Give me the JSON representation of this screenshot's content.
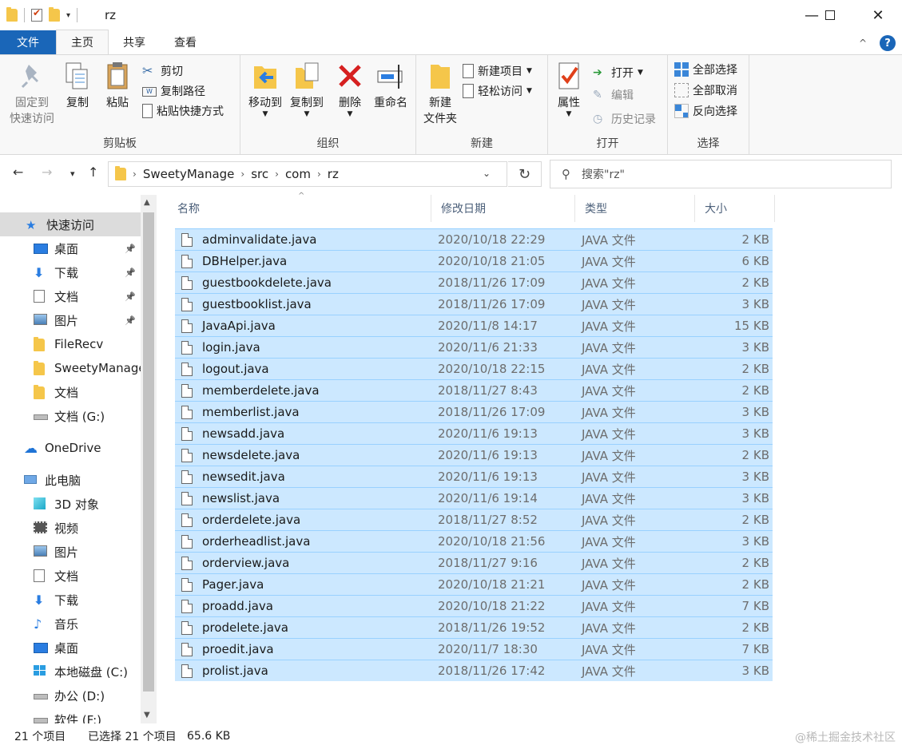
{
  "window": {
    "title": "rz"
  },
  "ribbon_tabs": [
    "文件",
    "主页",
    "共享",
    "查看"
  ],
  "ribbon": {
    "clipboard": {
      "label": "剪贴板",
      "pin_line1": "固定到",
      "pin_line2": "快速访问",
      "copy": "复制",
      "paste": "粘贴",
      "cut": "剪切",
      "copy_path": "复制路径",
      "paste_shortcut": "粘贴快捷方式"
    },
    "organize": {
      "label": "组织",
      "move_to": "移动到",
      "copy_to": "复制到",
      "delete": "删除",
      "rename": "重命名"
    },
    "new": {
      "label": "新建",
      "new_folder_line1": "新建",
      "new_folder_line2": "文件夹",
      "new_item": "新建项目",
      "easy_access": "轻松访问"
    },
    "open": {
      "label": "打开",
      "properties": "属性",
      "open": "打开",
      "edit": "编辑",
      "history": "历史记录"
    },
    "select": {
      "label": "选择",
      "select_all": "全部选择",
      "select_none": "全部取消",
      "invert": "反向选择"
    }
  },
  "address": {
    "segments": [
      "SweetyManage",
      "src",
      "com",
      "rz"
    ]
  },
  "search": {
    "placeholder": "搜索\"rz\""
  },
  "nav_items": [
    {
      "label": "快速访问",
      "icon": "star-icon",
      "pinned": false,
      "level": 0
    },
    {
      "label": "桌面",
      "icon": "desktop-icon",
      "pinned": true,
      "level": 1
    },
    {
      "label": "下载",
      "icon": "download-icon",
      "pinned": true,
      "level": 1
    },
    {
      "label": "文档",
      "icon": "document-icon",
      "pinned": true,
      "level": 1
    },
    {
      "label": "图片",
      "icon": "picture-icon",
      "pinned": true,
      "level": 1
    },
    {
      "label": "FileRecv",
      "icon": "folder-icon",
      "pinned": false,
      "level": 1
    },
    {
      "label": "SweetyManage",
      "icon": "folder-icon",
      "pinned": false,
      "level": 1
    },
    {
      "label": "文档",
      "icon": "folder-icon",
      "pinned": false,
      "level": 1
    },
    {
      "label": "文档 (G:)",
      "icon": "drive-icon",
      "pinned": false,
      "level": 1
    },
    {
      "label": "OneDrive",
      "icon": "cloud-icon",
      "pinned": false,
      "level": 0
    },
    {
      "label": "此电脑",
      "icon": "computer-icon",
      "pinned": false,
      "level": 0
    },
    {
      "label": "3D 对象",
      "icon": "cube-icon",
      "pinned": false,
      "level": 1
    },
    {
      "label": "视频",
      "icon": "video-icon",
      "pinned": false,
      "level": 1
    },
    {
      "label": "图片",
      "icon": "picture-icon",
      "pinned": false,
      "level": 1
    },
    {
      "label": "文档",
      "icon": "document-icon",
      "pinned": false,
      "level": 1
    },
    {
      "label": "下载",
      "icon": "download-icon",
      "pinned": false,
      "level": 1
    },
    {
      "label": "音乐",
      "icon": "music-icon",
      "pinned": false,
      "level": 1
    },
    {
      "label": "桌面",
      "icon": "desktop-icon",
      "pinned": false,
      "level": 1
    },
    {
      "label": "本地磁盘 (C:)",
      "icon": "windows-drive-icon",
      "pinned": false,
      "level": 1
    },
    {
      "label": "办公 (D:)",
      "icon": "drive-icon",
      "pinned": false,
      "level": 1
    },
    {
      "label": "软件 (F:)",
      "icon": "drive-icon",
      "pinned": false,
      "level": 1
    }
  ],
  "columns": {
    "name": "名称",
    "date": "修改日期",
    "type": "类型",
    "size": "大小"
  },
  "files": [
    {
      "name": "adminvalidate.java",
      "date": "2020/10/18 22:29",
      "type": "JAVA 文件",
      "size": "2 KB"
    },
    {
      "name": "DBHelper.java",
      "date": "2020/10/18 21:05",
      "type": "JAVA 文件",
      "size": "6 KB"
    },
    {
      "name": "guestbookdelete.java",
      "date": "2018/11/26 17:09",
      "type": "JAVA 文件",
      "size": "2 KB"
    },
    {
      "name": "guestbooklist.java",
      "date": "2018/11/26 17:09",
      "type": "JAVA 文件",
      "size": "3 KB"
    },
    {
      "name": "JavaApi.java",
      "date": "2020/11/8 14:17",
      "type": "JAVA 文件",
      "size": "15 KB"
    },
    {
      "name": "login.java",
      "date": "2020/11/6 21:33",
      "type": "JAVA 文件",
      "size": "3 KB"
    },
    {
      "name": "logout.java",
      "date": "2020/10/18 22:15",
      "type": "JAVA 文件",
      "size": "2 KB"
    },
    {
      "name": "memberdelete.java",
      "date": "2018/11/27 8:43",
      "type": "JAVA 文件",
      "size": "2 KB"
    },
    {
      "name": "memberlist.java",
      "date": "2018/11/26 17:09",
      "type": "JAVA 文件",
      "size": "3 KB"
    },
    {
      "name": "newsadd.java",
      "date": "2020/11/6 19:13",
      "type": "JAVA 文件",
      "size": "3 KB"
    },
    {
      "name": "newsdelete.java",
      "date": "2020/11/6 19:13",
      "type": "JAVA 文件",
      "size": "2 KB"
    },
    {
      "name": "newsedit.java",
      "date": "2020/11/6 19:13",
      "type": "JAVA 文件",
      "size": "3 KB"
    },
    {
      "name": "newslist.java",
      "date": "2020/11/6 19:14",
      "type": "JAVA 文件",
      "size": "3 KB"
    },
    {
      "name": "orderdelete.java",
      "date": "2018/11/27 8:52",
      "type": "JAVA 文件",
      "size": "2 KB"
    },
    {
      "name": "orderheadlist.java",
      "date": "2020/10/18 21:56",
      "type": "JAVA 文件",
      "size": "3 KB"
    },
    {
      "name": "orderview.java",
      "date": "2018/11/27 9:16",
      "type": "JAVA 文件",
      "size": "2 KB"
    },
    {
      "name": "Pager.java",
      "date": "2020/10/18 21:21",
      "type": "JAVA 文件",
      "size": "2 KB"
    },
    {
      "name": "proadd.java",
      "date": "2020/10/18 21:22",
      "type": "JAVA 文件",
      "size": "7 KB"
    },
    {
      "name": "prodelete.java",
      "date": "2018/11/26 19:52",
      "type": "JAVA 文件",
      "size": "2 KB"
    },
    {
      "name": "proedit.java",
      "date": "2020/11/7 18:30",
      "type": "JAVA 文件",
      "size": "7 KB"
    },
    {
      "name": "prolist.java",
      "date": "2018/11/26 17:42",
      "type": "JAVA 文件",
      "size": "3 KB"
    }
  ],
  "status": {
    "item_count": "21 个项目",
    "selected": "已选择 21 个项目",
    "selected_size": "65.6 KB"
  },
  "watermark": "@稀土掘金技术社区",
  "colors": {
    "accent": "#1a66b8",
    "selection": "#cce8ff",
    "selection_border": "#99d1ff",
    "folder": "#f5c64a"
  }
}
